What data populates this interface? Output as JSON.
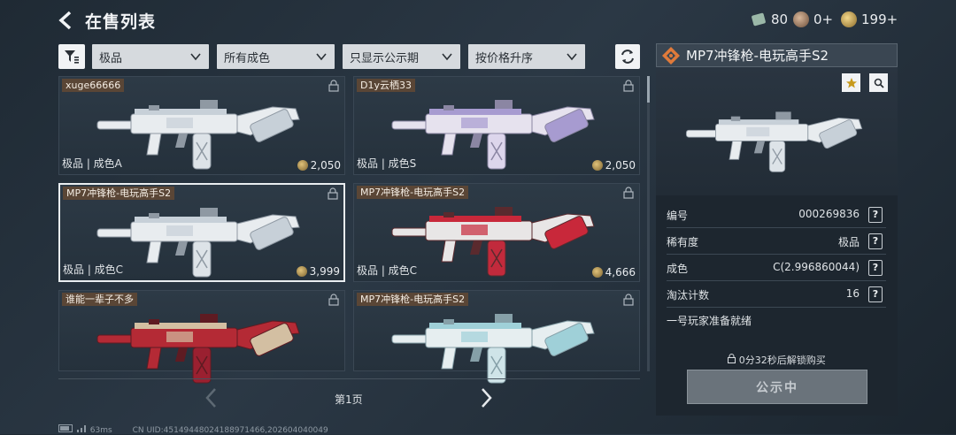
{
  "header": {
    "title": "在售列表"
  },
  "currency": [
    {
      "icon": "ticket-icon",
      "value": "80"
    },
    {
      "icon": "skull-coin-icon",
      "value": "0+"
    },
    {
      "icon": "gold-coin-icon",
      "value": "199+"
    }
  ],
  "filters": {
    "rarity": "极品",
    "wear": "所有成色",
    "period": "只显示公示期",
    "sort": "按价格升序"
  },
  "listings": [
    {
      "seller": "xuge66666",
      "rarity_wear": "极品 | 成色A",
      "price": "2,050",
      "skin": "white"
    },
    {
      "seller": "D1y云栖33",
      "rarity_wear": "极品 | 成色S",
      "price": "2,050",
      "skin": "violet"
    },
    {
      "seller": "MP7冲锋枪-电玩高手S2",
      "rarity_wear": "极品 | 成色C",
      "price": "3,999",
      "skin": "white"
    },
    {
      "seller": "MP7冲锋枪-电玩高手S2",
      "rarity_wear": "极品 | 成色C",
      "price": "4,666",
      "skin": "red"
    },
    {
      "seller": "谁能一辈子不多",
      "rarity_wear": "",
      "price": "",
      "skin": "crimson"
    },
    {
      "seller": "MP7冲锋枪-电玩高手S2",
      "rarity_wear": "",
      "price": "",
      "skin": "teal"
    }
  ],
  "pagination": {
    "label": "第1页"
  },
  "footer": {
    "ping": "63ms",
    "uid": "CN UID:45149448024188971466,202604040049"
  },
  "detail": {
    "title": "MP7冲锋枪-电玩高手S2",
    "fields": [
      {
        "label": "编号",
        "value": "000269836"
      },
      {
        "label": "稀有度",
        "value": "极品"
      },
      {
        "label": "成色",
        "value": "C(2.996860044)"
      },
      {
        "label": "淘汰计数",
        "value": "16"
      }
    ],
    "description": "一号玩家准备就绪",
    "unlock_text": "0分32秒后解锁购买",
    "button_label": "公示中"
  },
  "colors": {
    "seller_tag": "#5a4636",
    "accent": "#e07a3a"
  }
}
